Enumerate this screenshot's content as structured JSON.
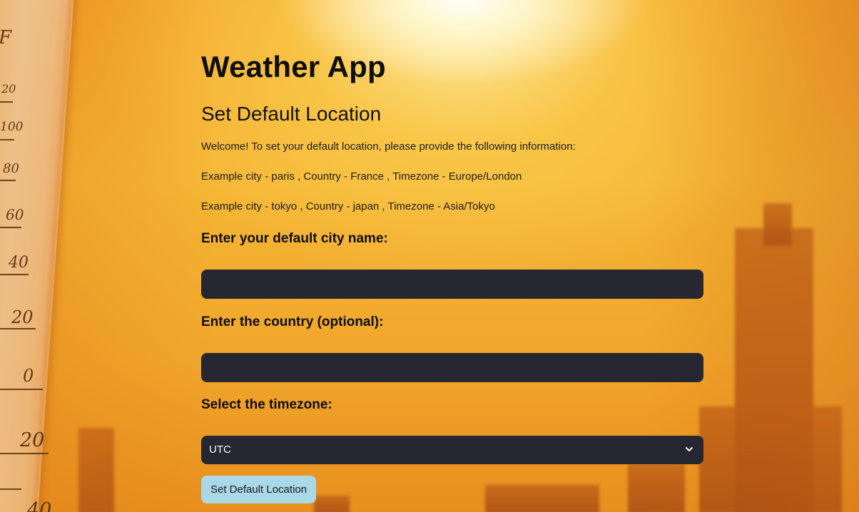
{
  "app": {
    "title": "Weather App",
    "subtitle": "Set Default Location"
  },
  "intro": {
    "welcome": "Welcome! To set your default location, please provide the following information:",
    "example1": "Example city - paris , Country - France , Timezone - Europe/London",
    "example2": "Example city - tokyo , Country - japan , Timezone - Asia/Tokyo"
  },
  "form": {
    "city_label": "Enter your default city name:",
    "city_value": "",
    "country_label": "Enter the country (optional):",
    "country_value": "",
    "timezone_label": "Select the timezone:",
    "timezone_value": "UTC",
    "submit_label": "Set Default Location"
  },
  "thermometer": {
    "labels": [
      "F",
      "20",
      "100",
      "80",
      "60",
      "40",
      "20",
      "0",
      "20",
      "40"
    ]
  },
  "colors": {
    "input_bg": "#262730",
    "button_bg": "#a9d8e6",
    "background": "#f2a52a"
  }
}
